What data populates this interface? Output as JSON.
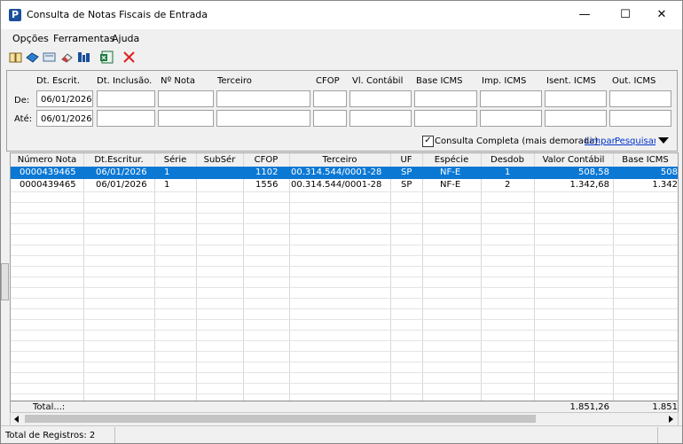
{
  "window": {
    "title": "Consulta de Notas Fiscais de Entrada",
    "app_icon": "P",
    "minimize": "—",
    "maximize": "☐",
    "close": "✕"
  },
  "menu": {
    "items": [
      {
        "label": "Opções"
      },
      {
        "label": "Ferramentas"
      },
      {
        "label": "Ajuda"
      }
    ]
  },
  "toolbar": {
    "icons": [
      "book-icon",
      "book-open-icon",
      "card-icon",
      "eraser-icon",
      "filter-icon",
      "excel-export-icon",
      "delete-icon"
    ]
  },
  "filter": {
    "headers": [
      "Dt. Escrit.",
      "Dt. Inclusão.",
      "Nº Nota",
      "Terceiro",
      "CFOP",
      "Vl. Contábil",
      "Base ICMS",
      "Imp. ICMS",
      "Isent. ICMS",
      "Out. ICMS"
    ],
    "from_label": "De:",
    "to_label": "Até:",
    "from_date": "06/01/2026",
    "to_date": "06/01/2026",
    "checkbox_label": "Consulta Completa (mais demorada)",
    "checkbox_checked": true,
    "checkbox_mark": "✓",
    "clear_link": "Limpar",
    "search_link": "Pesquisar"
  },
  "table": {
    "columns": [
      "Número Nota",
      "Dt.Escritur.",
      "Série",
      "SubSér",
      "CFOP",
      "Terceiro",
      "UF",
      "Espécie",
      "Desdob",
      "Valor Contábil",
      "Base ICMS"
    ],
    "rows": [
      {
        "numero": "0000439465",
        "data": "06/01/2026",
        "serie": "1",
        "subser": "",
        "cfop": "1102",
        "terceiro": "00.314.544/0001-28",
        "uf": "SP",
        "especie": "NF-E",
        "desdob": "1",
        "valor": "508,58",
        "base": "508",
        "selected": true
      },
      {
        "numero": "0000439465",
        "data": "06/01/2026",
        "serie": "1",
        "subser": "",
        "cfop": "1556",
        "terceiro": "00.314.544/0001-28",
        "uf": "SP",
        "especie": "NF-E",
        "desdob": "2",
        "valor": "1.342,68",
        "base": "1.342",
        "selected": false
      }
    ],
    "total_label": "Total...:",
    "total_valor": "1.851,26",
    "total_base": "1.851"
  },
  "status": {
    "text": "Total de Registros: 2"
  }
}
